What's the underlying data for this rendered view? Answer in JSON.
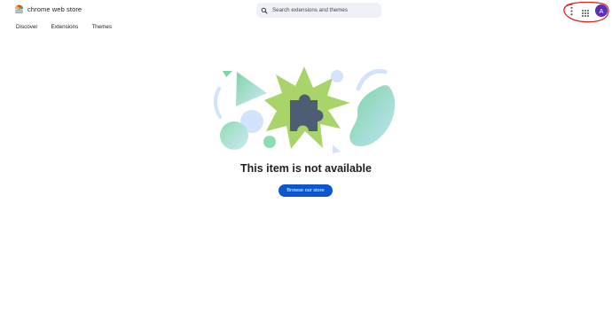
{
  "header": {
    "logo_text": "chrome web store",
    "search_placeholder": "Search extensions and themes",
    "avatar_initial": "A"
  },
  "nav": {
    "tabs": [
      {
        "label": "Discover"
      },
      {
        "label": "Extensions"
      },
      {
        "label": "Themes"
      }
    ]
  },
  "main": {
    "title": "This item is not available",
    "cta_label": "Browse our store"
  },
  "colors": {
    "primary_button": "#0b57d0",
    "avatar": "#5b2fb3",
    "annotation": "#e0231c",
    "search_bg": "#eef1f8",
    "puzzle": "#4e5d73",
    "star": "#a8d46a",
    "mint": "#86d8b0",
    "light_blue": "#d3e3fd"
  },
  "icons": {
    "logo": "chrome-web-store-logo",
    "search": "search-icon",
    "menu": "more-vert-icon",
    "apps": "apps-grid-icon",
    "illustration": "puzzle-piece-illustration"
  }
}
